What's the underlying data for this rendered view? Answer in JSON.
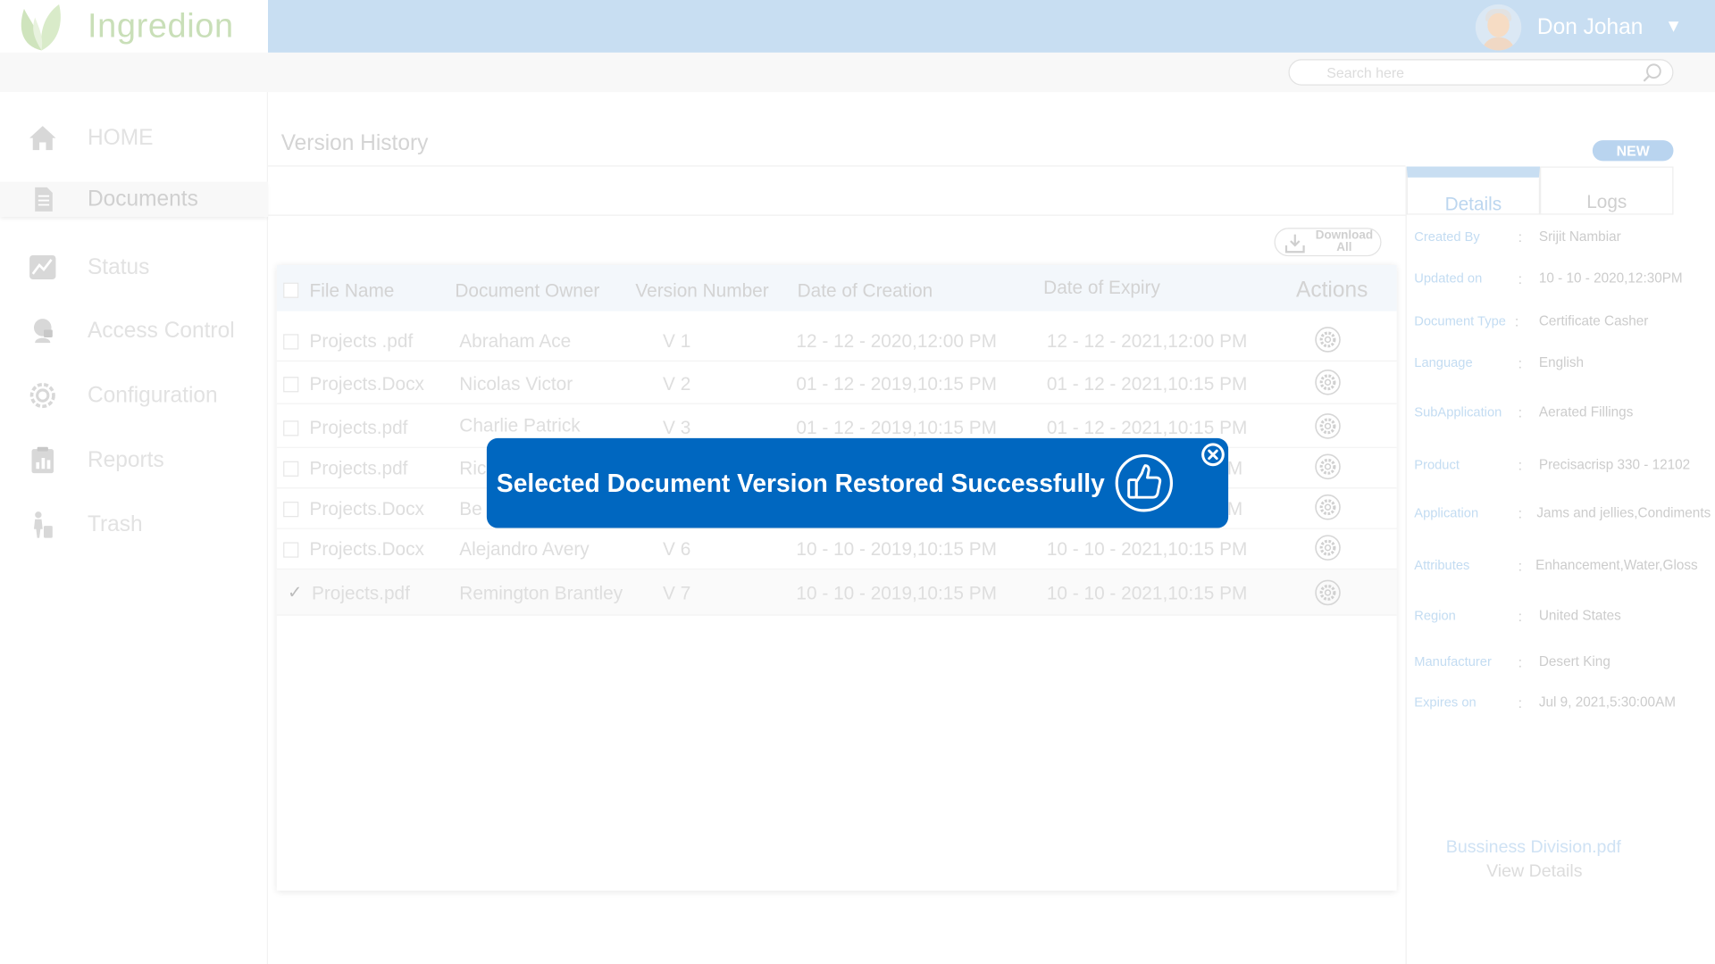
{
  "app": {
    "name": "Ingredion"
  },
  "user": {
    "name": "Don Johan",
    "caret": "▼"
  },
  "search": {
    "placeholder": "Search here"
  },
  "sidebar": {
    "items": [
      {
        "label": "HOME",
        "icon": "home-icon"
      },
      {
        "label": "Documents",
        "icon": "document-icon"
      },
      {
        "label": "Status",
        "icon": "status-chart-icon"
      },
      {
        "label": "Access Control",
        "icon": "access-control-icon"
      },
      {
        "label": "Configuration",
        "icon": "configuration-icon"
      },
      {
        "label": "Reports",
        "icon": "reports-icon"
      },
      {
        "label": "Trash",
        "icon": "trash-icon"
      }
    ]
  },
  "main": {
    "title": "Version History",
    "new_label": "NEW",
    "download_label": "Download\nAll"
  },
  "table": {
    "headers": [
      "File Name",
      "Document Owner",
      "Version Number",
      "Date of Creation",
      "Date of Expiry",
      "Actions"
    ],
    "rows": [
      {
        "file": "Projects .pdf",
        "owner": "Abraham Ace",
        "version": "V 1",
        "created": "12 - 12 - 2020,12:00 PM",
        "expiry": "12 - 12 - 2021,12:00 PM",
        "checked": false
      },
      {
        "file": "Projects.Docx",
        "owner": "Nicolas Victor",
        "version": "V 2",
        "created": "01 - 12 - 2019,10:15 PM",
        "expiry": "01 - 12 - 2021,10:15 PM",
        "checked": false
      },
      {
        "file": "Projects.pdf",
        "owner": "Charlie Patrick",
        "version": "V 3",
        "created": "01 - 12 - 2019,10:15 PM",
        "expiry": "01 - 12 - 2021,10:15 PM",
        "checked": false
      },
      {
        "file": "Projects.pdf",
        "owner": "Ric",
        "version": "",
        "created": "",
        "expiry": "M",
        "checked": false
      },
      {
        "file": "Projects.Docx",
        "owner": "Be",
        "version": "",
        "created": "",
        "expiry": "M",
        "checked": false
      },
      {
        "file": "Projects.Docx",
        "owner": "Alejandro Avery",
        "version": "V 6",
        "created": "10 - 10 - 2019,10:15 PM",
        "expiry": "10 - 10 - 2021,10:15 PM",
        "checked": false
      },
      {
        "file": "Projects.pdf",
        "owner": "Remington Brantley",
        "version": "V 7",
        "created": "10 - 10 - 2019,10:15 PM",
        "expiry": "10 - 10 - 2021,10:15 PM",
        "checked": true
      }
    ]
  },
  "details_panel": {
    "tabs": [
      "Details",
      "Logs"
    ],
    "fields": [
      {
        "key": "Created By",
        "value": "Srijit Nambiar"
      },
      {
        "key": "Updated on",
        "value": "10 - 10 - 2020,12:30PM"
      },
      {
        "key": "Document Type",
        "value": "Certificate Casher"
      },
      {
        "key": "Language",
        "value": "English"
      },
      {
        "key": "SubApplication",
        "value": "Aerated Fillings"
      },
      {
        "key": "Product",
        "value": "Precisacrisp 330 - 12102"
      },
      {
        "key": "Application",
        "value": "Jams and jellies,Condiments"
      },
      {
        "key": "Attributes",
        "value": "Enhancement,Water,Gloss"
      },
      {
        "key": "Region",
        "value": "United States"
      },
      {
        "key": "Manufacturer",
        "value": "Desert King"
      },
      {
        "key": "Expires on",
        "value": "Jul 9, 2021,5:30:00AM"
      }
    ],
    "file_name": "Bussiness Division.pdf",
    "view_details": "View Details"
  },
  "toast": {
    "message": "Selected Document Version Restored Successfully",
    "icon": "thumbs-up-icon",
    "close_icon": "close-icon"
  },
  "colors": {
    "topbar": "#c8def2",
    "toast": "#0067c0",
    "new_badge": "#b9d4ef"
  }
}
